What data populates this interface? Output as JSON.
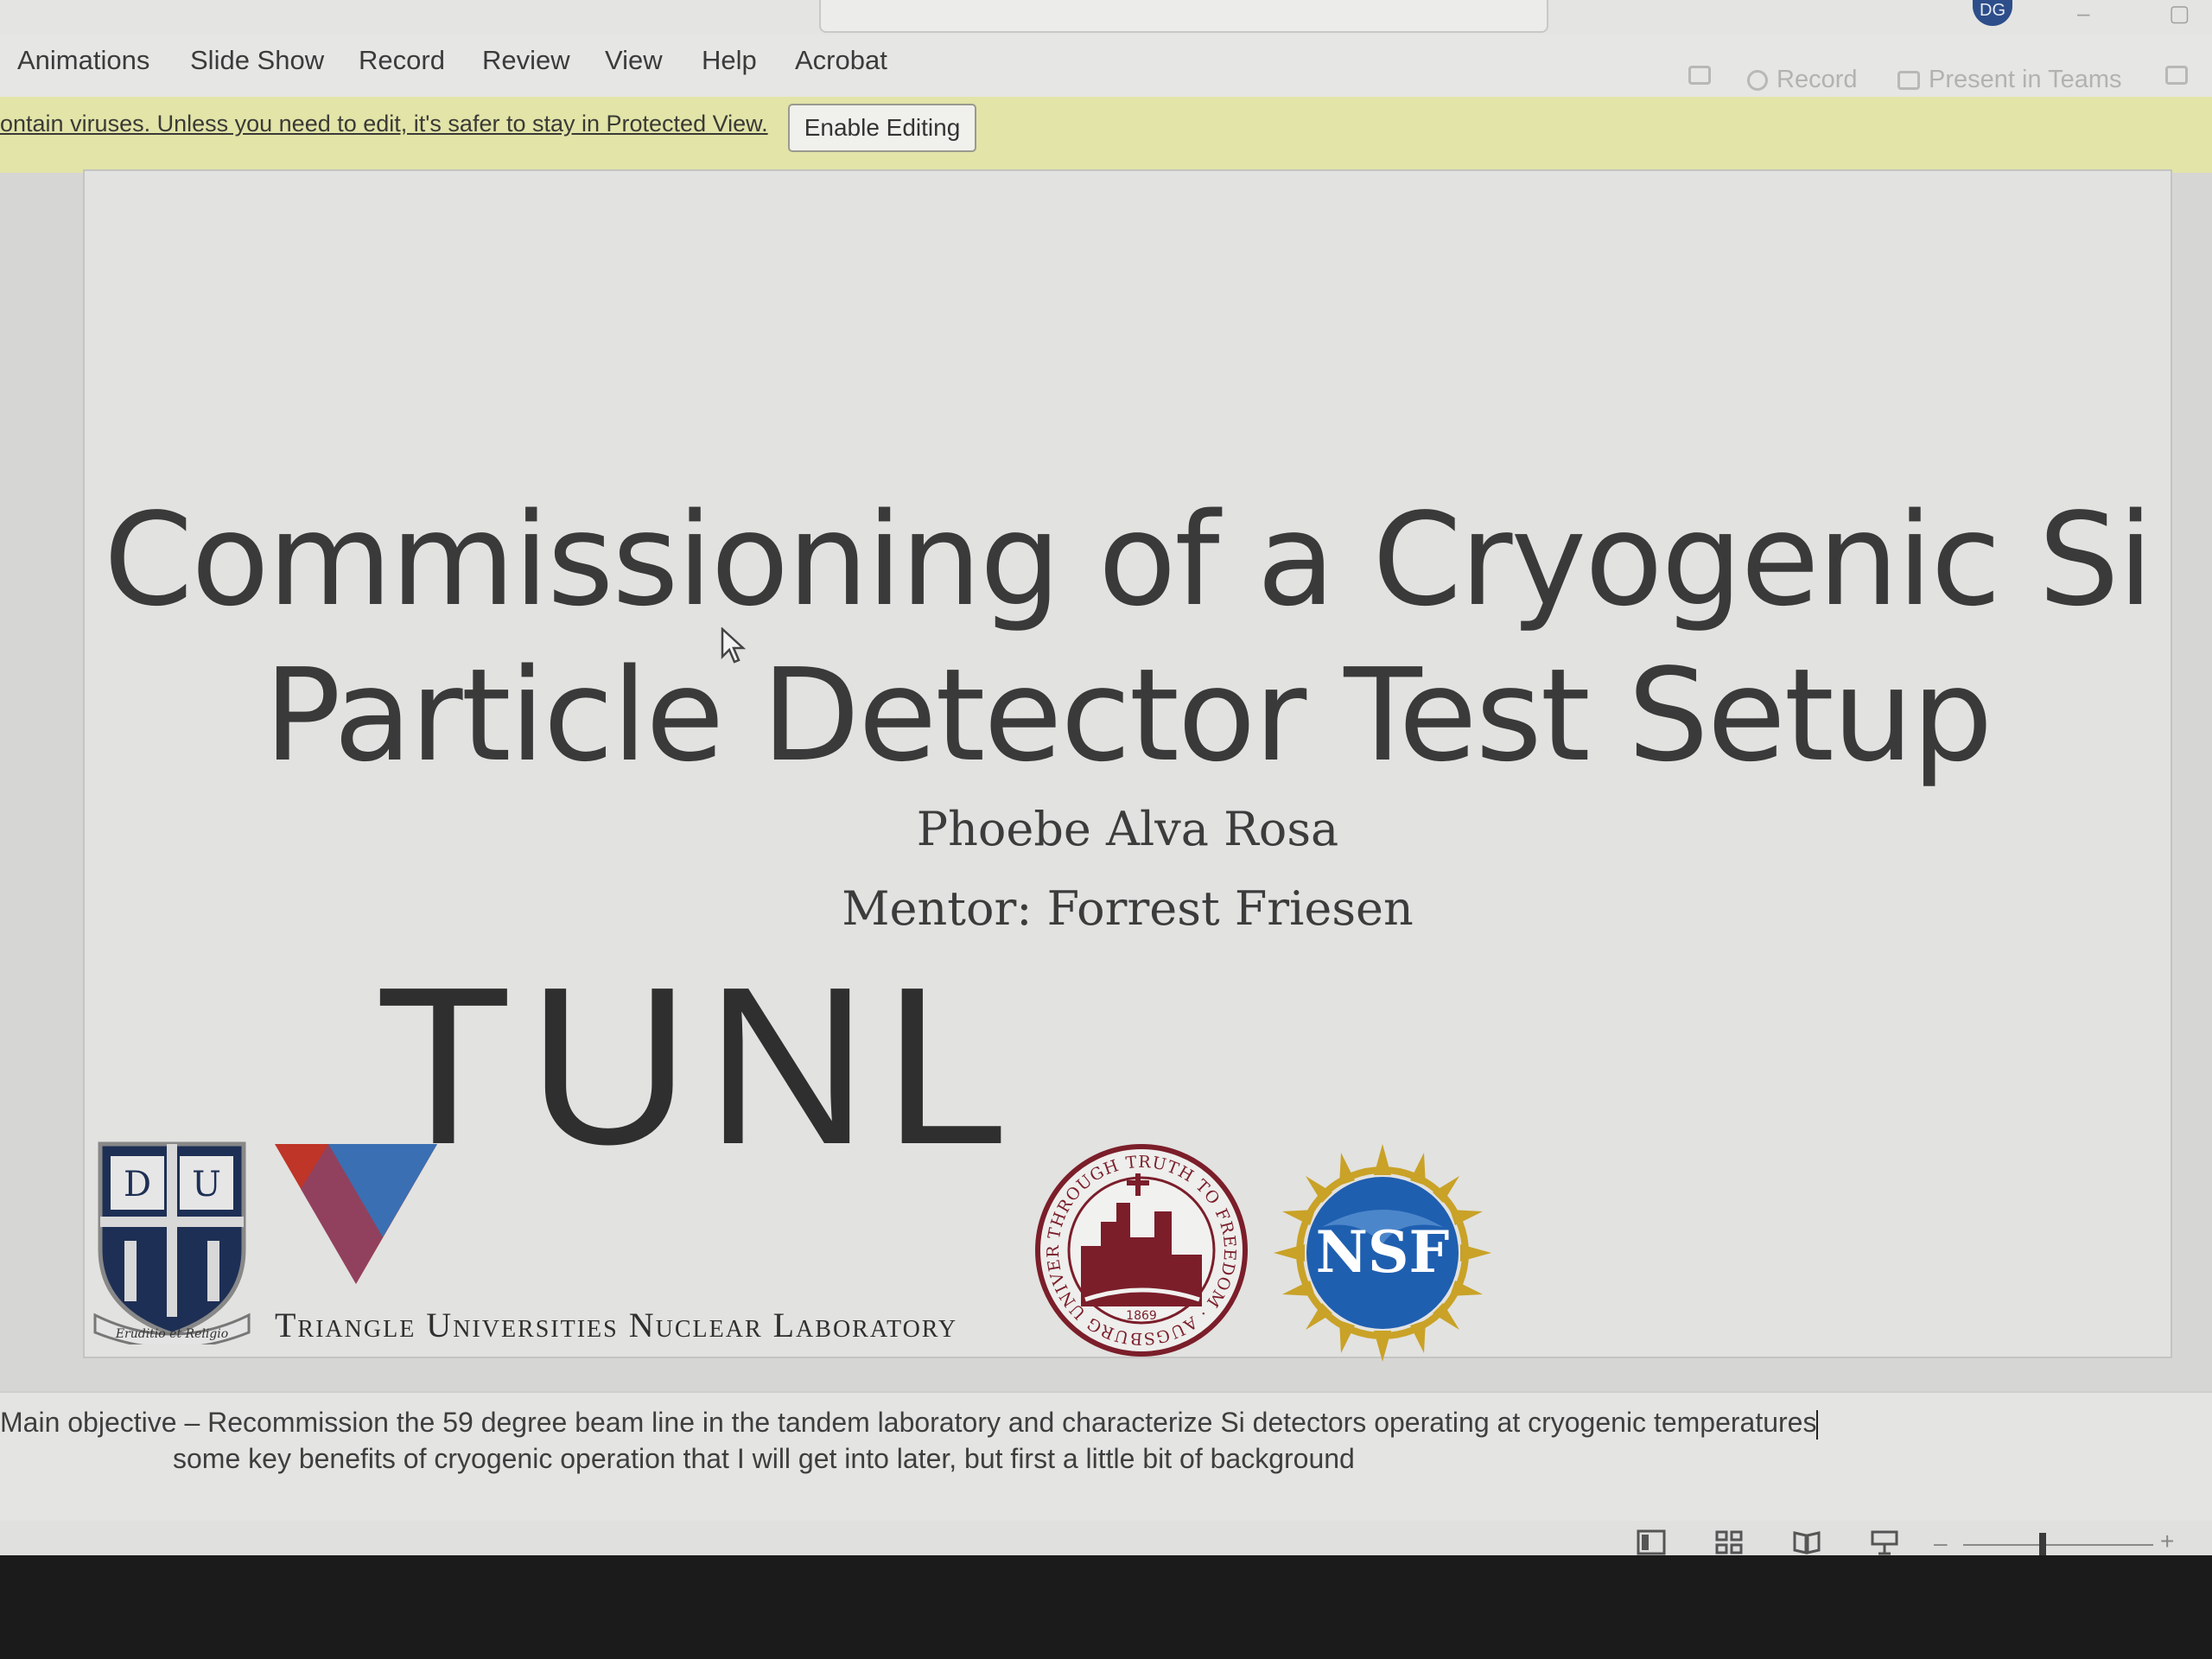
{
  "window": {
    "avatar_initials": "DG"
  },
  "ribbon": {
    "tabs": [
      "Animations",
      "Slide Show",
      "Record",
      "Review",
      "View",
      "Help",
      "Acrobat"
    ],
    "record_label": "Record",
    "present_label": "Present in Teams"
  },
  "protected_view": {
    "message": "ontain viruses. Unless you need to edit, it's safer to stay in Protected View.",
    "enable_button": "Enable Editing"
  },
  "slide": {
    "title_line1": "Commissioning of a Cryogenic Si",
    "title_line2": "Particle Detector Test Setup",
    "author": "Phoebe Alva Rosa",
    "mentor": "Mentor: Forrest Friesen",
    "logos": {
      "tunl_wordmark": "TUNL",
      "tunl_subtitle": "Triangle Universities Nuclear Laboratory",
      "duke_motto": "Eruditio et Religio",
      "augsburg_ring": "THROUGH TRUTH TO FREEDOM · AUGSBURG UNIVERSITY",
      "augsburg_year": "1869",
      "nsf_text": "NSF"
    }
  },
  "notes": {
    "line1": "Main objective – Recommission the 59 degree beam line in the tandem laboratory and characterize Si detectors operating at cryogenic temperatures",
    "line2": "some key benefits of cryogenic operation that I will get into later, but first a little bit of background"
  },
  "colors": {
    "protected_bar": "#e2e4a8",
    "tunl_red": "#c0392b",
    "tunl_blue": "#3a6fb3",
    "augsburg_maroon": "#7b1e2a",
    "nsf_blue": "#1f5fb0",
    "nsf_gold": "#c9a227"
  }
}
